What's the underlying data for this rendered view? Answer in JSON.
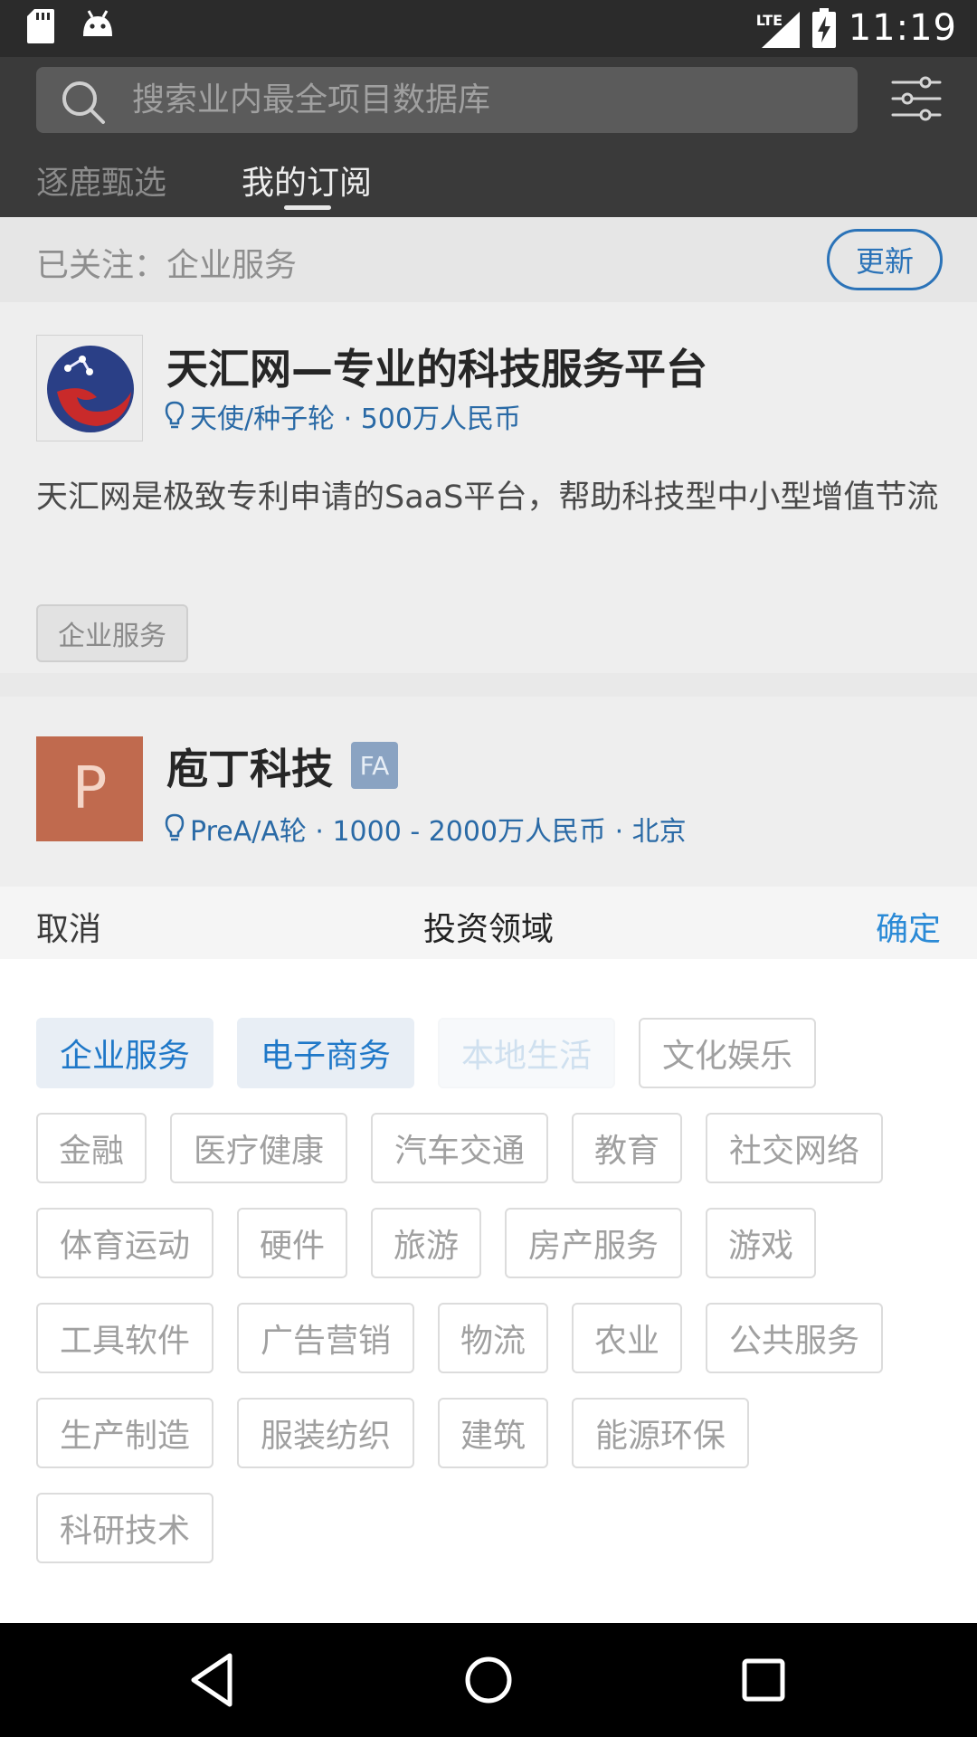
{
  "status_bar": {
    "time": "11:19",
    "network": "LTE",
    "icons": [
      "sd-card-icon",
      "android-icon",
      "signal-icon",
      "battery-charging-icon"
    ]
  },
  "search": {
    "placeholder": "搜索业内最全项目数据库"
  },
  "tabs": [
    {
      "label": "逐鹿甄选",
      "active": false
    },
    {
      "label": "我的订阅",
      "active": true
    }
  ],
  "follow": {
    "text": "已关注：企业服务",
    "update_label": "更新",
    "accent": "#2b73b8"
  },
  "projects": [
    {
      "title": "天汇网—专业的科技服务平台",
      "meta": "天使/种子轮 · 500万人民币",
      "description": "天汇网是极致专利申请的SaaS平台，帮助科技型中小型增值节流",
      "tag": "企业服务"
    },
    {
      "logo_letter": "P",
      "title": "庖丁科技",
      "badge": "FA",
      "meta": "PreA/A轮 · 1000 - 2000万人民币 · 北京"
    }
  ],
  "sheet": {
    "cancel": "取消",
    "title": "投资领域",
    "confirm": "确定",
    "accent": "#2b8ad6",
    "chips": [
      {
        "label": "企业服务",
        "state": "selected"
      },
      {
        "label": "电子商务",
        "state": "selected"
      },
      {
        "label": "本地生活",
        "state": "faded"
      },
      {
        "label": "文化娱乐",
        "state": "normal"
      },
      {
        "label": "金融",
        "state": "normal"
      },
      {
        "label": "医疗健康",
        "state": "normal"
      },
      {
        "label": "汽车交通",
        "state": "normal"
      },
      {
        "label": "教育",
        "state": "normal"
      },
      {
        "label": "社交网络",
        "state": "normal"
      },
      {
        "label": "体育运动",
        "state": "normal"
      },
      {
        "label": "硬件",
        "state": "normal"
      },
      {
        "label": "旅游",
        "state": "normal"
      },
      {
        "label": "房产服务",
        "state": "normal"
      },
      {
        "label": "游戏",
        "state": "normal"
      },
      {
        "label": "工具软件",
        "state": "normal"
      },
      {
        "label": "广告营销",
        "state": "normal"
      },
      {
        "label": "物流",
        "state": "normal"
      },
      {
        "label": "农业",
        "state": "normal"
      },
      {
        "label": "公共服务",
        "state": "normal"
      },
      {
        "label": "生产制造",
        "state": "normal"
      },
      {
        "label": "服装纺织",
        "state": "normal"
      },
      {
        "label": "建筑",
        "state": "normal"
      },
      {
        "label": "能源环保",
        "state": "normal"
      },
      {
        "label": "科研技术",
        "state": "normal"
      }
    ]
  }
}
